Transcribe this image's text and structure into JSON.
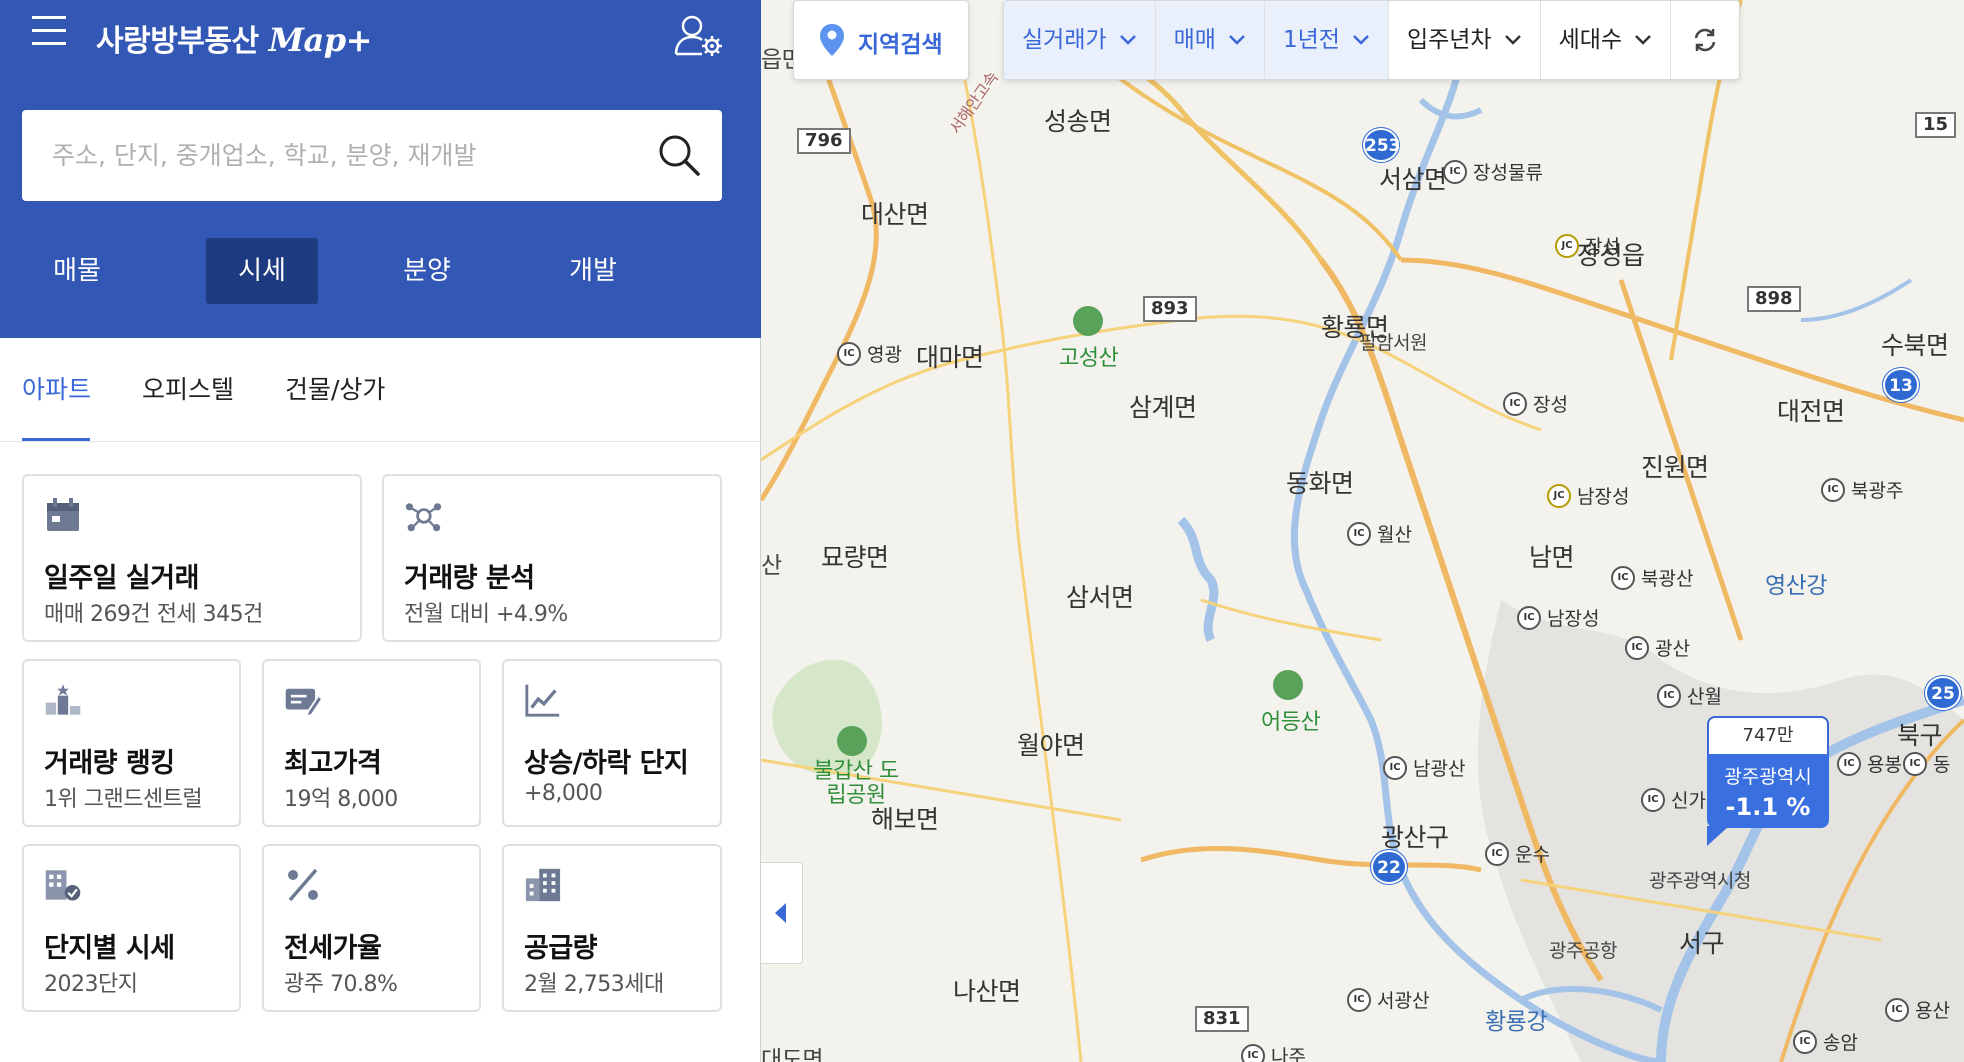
{
  "app": {
    "brand_name": "사랑방부동산",
    "brand_suffix": "Map+"
  },
  "search": {
    "placeholder": "주소, 단지, 중개업소, 학교, 분양, 재개발"
  },
  "main_tabs": [
    "매물",
    "시세",
    "분양",
    "개발"
  ],
  "main_tab_active": "시세",
  "sub_tabs": [
    "아파트",
    "오피스텔",
    "건물/상가"
  ],
  "sub_tab_active": "아파트",
  "cards": [
    {
      "icon": "calendar-icon",
      "title": "일주일 실거래",
      "sub": "매매 269건   전세 345건"
    },
    {
      "icon": "network-icon",
      "title": "거래량 분석",
      "sub": "전월 대비 +4.9%"
    },
    {
      "icon": "ranking-icon",
      "title": "거래량 랭킹",
      "sub": "1위 그랜드센트럴"
    },
    {
      "icon": "price-tag-icon",
      "title": "최고가격",
      "sub": "19억 8,000"
    },
    {
      "icon": "trend-chart-icon",
      "title": "상승/하락 단지",
      "sub": "+8,000"
    },
    {
      "icon": "building-check-icon",
      "title": "단지별 시세",
      "sub": "2023단지"
    },
    {
      "icon": "percent-icon",
      "title": "전세가율",
      "sub": "광주 70.8%"
    },
    {
      "icon": "apartment-icon",
      "title": "공급량",
      "sub": "2월 2,753세대"
    }
  ],
  "map_controls": {
    "region_search": "지역검색",
    "filters": [
      {
        "label": "실거래가",
        "highlighted": true
      },
      {
        "label": "매매",
        "highlighted": true
      },
      {
        "label": "1년전",
        "highlighted": true
      },
      {
        "label": "입주년차",
        "highlighted": false
      },
      {
        "label": "세대수",
        "highlighted": false
      }
    ]
  },
  "price_marker": {
    "price": "747만",
    "region": "광주광역시",
    "change": "-1.1 %"
  },
  "map_labels": {
    "places": [
      "성송면",
      "대산면",
      "대마면",
      "삼계면",
      "묘량면",
      "삼서면",
      "월야면",
      "해보면",
      "나산면",
      "황룡면",
      "동화면",
      "진원면",
      "대전면",
      "수북면",
      "남면",
      "광산구",
      "서구",
      "북구",
      "영산강",
      "황룡강",
      "장성읍",
      "서삼면",
      "대도면",
      "산"
    ],
    "landmarks": [
      "고성산",
      "어등산",
      "불갑산 도립공원",
      "필암서원",
      "광주광역시청",
      "광주공항",
      "서해안고속"
    ],
    "interchanges": [
      "영광",
      "장성물류",
      "장성",
      "월산",
      "북광산",
      "남장성",
      "광산",
      "산월",
      "남광산",
      "신가",
      "운수",
      "서광산",
      "나주",
      "북광주",
      "용봉",
      "동",
      "송암",
      "용산",
      "남장성"
    ],
    "junctions": [
      "장성",
      "남장성"
    ],
    "road_numbers": [
      "796",
      "893",
      "898",
      "831",
      "15"
    ],
    "highway_numbers": [
      "253",
      "13",
      "22",
      "25"
    ],
    "edge_labels": [
      "읍면",
      "산",
      "대도면"
    ]
  }
}
